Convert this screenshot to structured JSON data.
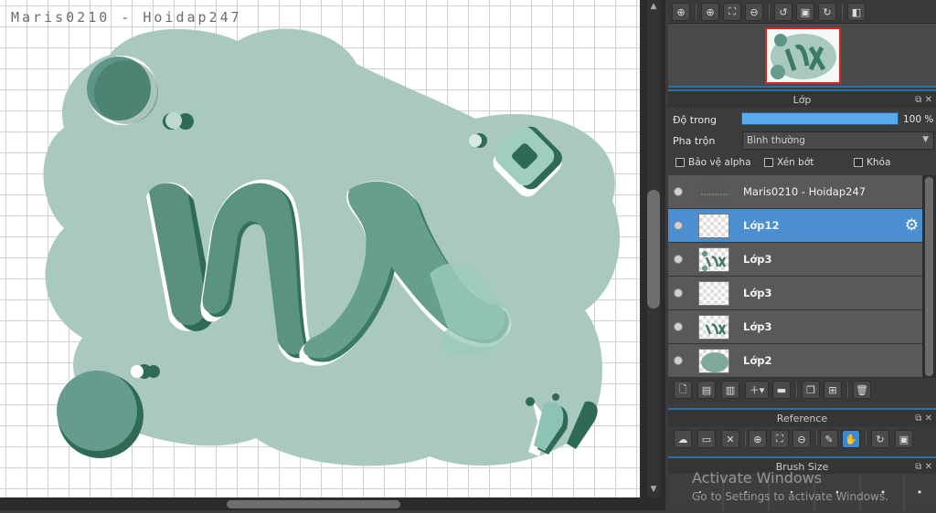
{
  "canvas": {
    "title": "Maris0210 - Hoidap247"
  },
  "panels": {
    "layer": {
      "title": "Lớp",
      "opacity_label": "Độ trong",
      "opacity_value": "100 %",
      "opacity_fraction": 1.0,
      "blend_label": "Pha trộn",
      "blend_value": "Bình thường",
      "protect_alpha": "Bảo vệ alpha",
      "clipping": "Xén bớt",
      "lock": "Khóa",
      "layers": [
        {
          "name": "Maris0210 - Hoidap247",
          "selected": false
        },
        {
          "name": "Lớp12",
          "selected": true
        },
        {
          "name": "Lớp3",
          "selected": false
        },
        {
          "name": "Lớp3",
          "selected": false
        },
        {
          "name": "Lớp3",
          "selected": false
        },
        {
          "name": "Lớp2",
          "selected": false
        }
      ]
    },
    "reference": {
      "title": "Reference"
    },
    "brush_size": {
      "title": "Brush Size"
    }
  },
  "watermark": {
    "line1": "Activate Windows",
    "line2": "Go to Settings to activate Windows."
  },
  "colors": {
    "accent": "#4b8fd0",
    "selected_layer": "#4b8fd0",
    "blob": "#a9c9c0",
    "ink": "#3d7a66"
  }
}
